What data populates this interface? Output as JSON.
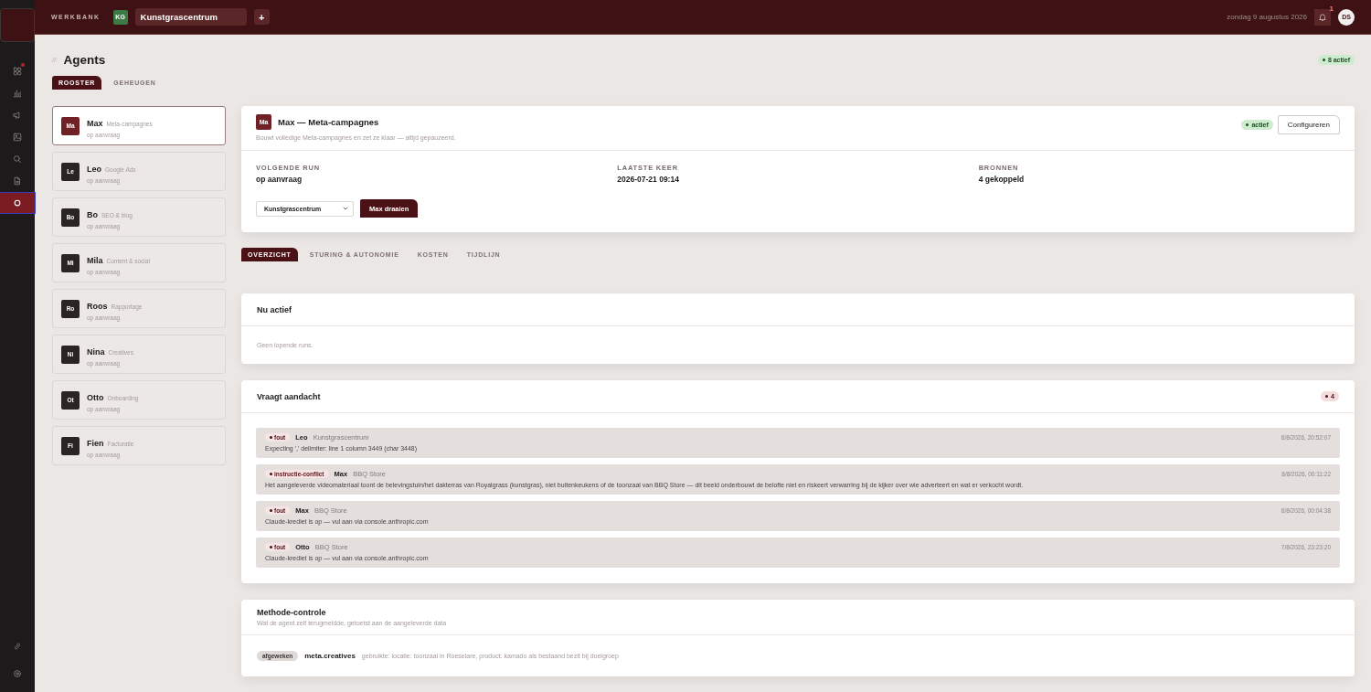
{
  "sidebar": {
    "items": [
      {
        "selected": false,
        "alert": true
      },
      {
        "selected": false,
        "alert": false
      },
      {
        "selected": false,
        "alert": false
      },
      {
        "selected": false,
        "alert": false
      },
      {
        "selected": false,
        "alert": false
      },
      {
        "selected": false,
        "alert": false
      },
      {
        "selected": true,
        "alert": false
      }
    ]
  },
  "topbar": {
    "brand": "WERKBANK",
    "workspace_initials": "KG",
    "workspace": "Kunstgrascentrum",
    "add": "+",
    "date": "zondag 9 augustus 2026",
    "notifications": "1",
    "user": "DS"
  },
  "page": {
    "marker": "//",
    "title": "Agents",
    "status": "8 actief"
  },
  "tabs": [
    {
      "label": "ROOSTER",
      "selected": true
    },
    {
      "label": "GEHEUGEN",
      "selected": false
    }
  ],
  "agents": [
    {
      "initials": "Ma",
      "name": "Max",
      "role": "Meta-campagnes",
      "schedule": "op aanvraag",
      "selected": true
    },
    {
      "initials": "Le",
      "name": "Leo",
      "role": "Google Ads",
      "schedule": "op aanvraag",
      "selected": false
    },
    {
      "initials": "Bo",
      "name": "Bo",
      "role": "SEO & blog",
      "schedule": "op aanvraag",
      "selected": false
    },
    {
      "initials": "Mi",
      "name": "Mila",
      "role": "Content & social",
      "schedule": "op aanvraag",
      "selected": false
    },
    {
      "initials": "Ro",
      "name": "Roos",
      "role": "Rapportage",
      "schedule": "op aanvraag",
      "selected": false
    },
    {
      "initials": "Ni",
      "name": "Nina",
      "role": "Creatives",
      "schedule": "op aanvraag",
      "selected": false
    },
    {
      "initials": "Ot",
      "name": "Otto",
      "role": "Onboarding",
      "schedule": "op aanvraag",
      "selected": false
    },
    {
      "initials": "Fi",
      "name": "Fien",
      "role": "Facturatie",
      "schedule": "op aanvraag",
      "selected": false
    }
  ],
  "detail": {
    "initials": "Ma",
    "title": "Max — Meta-campagnes",
    "description": "Bouwt volledige Meta-campagnes en zet ze klaar — altijd gepauzeerd.",
    "status": "actief",
    "configure": "Configureren",
    "stats": [
      {
        "label": "VOLGENDE RUN",
        "value": "op aanvraag"
      },
      {
        "label": "LAATSTE KEER",
        "value": "2026-07-21 09:14"
      },
      {
        "label": "BRONNEN",
        "value": "4 gekoppeld"
      }
    ],
    "select": "Kunstgrascentrum",
    "run": "Max draaien"
  },
  "detail_tabs": [
    {
      "label": "OVERZICHT",
      "selected": true
    },
    {
      "label": "STURING & AUTONOMIE",
      "selected": false
    },
    {
      "label": "KOSTEN",
      "selected": false
    },
    {
      "label": "TIJDLIJN",
      "selected": false
    }
  ],
  "now_active": {
    "title": "Nu actief",
    "empty": "Geen lopende runs."
  },
  "attention": {
    "title": "Vraagt aandacht",
    "count": "4",
    "items": [
      {
        "tag": "fout",
        "agent": "Leo",
        "client": "Kunstgrascentrum",
        "time": "8/8/2026, 20:52:07",
        "message": "Expecting ',' delimiter: line 1 column 3449 (char 3448)"
      },
      {
        "tag": "instructie-conflict",
        "agent": "Max",
        "client": "BBQ Store",
        "time": "8/8/2026, 00:11:22",
        "message": "Het aangeleverde videomateriaal toont de belevingstuin/het dakterras van Royalgrass (kunstgras), niet buitenkeukens of de toonzaal van BBQ Store — dit beeld onderbouwt de belofte niet en riskeert verwarring bij de kijker over wie adverteert en wat er verkocht wordt."
      },
      {
        "tag": "fout",
        "agent": "Max",
        "client": "BBQ Store",
        "time": "8/8/2026, 00:04:38",
        "message": "Claude-krediet is op — vul aan via console.anthropic.com"
      },
      {
        "tag": "fout",
        "agent": "Otto",
        "client": "BBQ Store",
        "time": "7/8/2026, 23:23:20",
        "message": "Claude-krediet is op — vul aan via console.anthropic.com"
      }
    ]
  },
  "method_check": {
    "title": "Methode-controle",
    "subtitle": "Wat de agent zelf terugmeldde, getoetst aan de aangeleverde data",
    "items": [
      {
        "tag": "afgeweken",
        "key": "meta.creatives",
        "detail": "gebruikte: locatie: toonzaal in Roeselare, product: kamado als bestaand bezit bij doelgroep"
      }
    ]
  }
}
